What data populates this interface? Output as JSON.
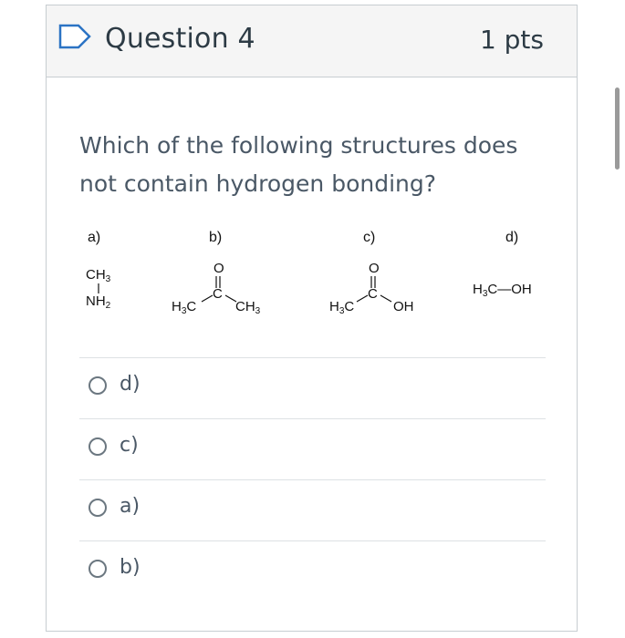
{
  "question": {
    "title": "Question 4",
    "points": "1 pts",
    "text": "Which of the following structures does not contain hydrogen bonding?"
  },
  "structures": {
    "a": {
      "label": "a)",
      "top_group": "CH",
      "top_sub": "3",
      "bottom_group": "NH",
      "bottom_sub": "2"
    },
    "b": {
      "label": "b)",
      "oxygen": "O",
      "carbon": "C",
      "left_group": "H",
      "left_sub": "3",
      "left_tail": "C",
      "right_group": "CH",
      "right_sub": "3"
    },
    "c": {
      "label": "c)",
      "oxygen": "O",
      "carbon": "C",
      "left_group": "H",
      "left_sub": "3",
      "left_tail": "C",
      "right_group": "OH"
    },
    "d": {
      "label": "d)",
      "formula_head": "H",
      "formula_sub": "3",
      "formula_tail": "C—OH"
    }
  },
  "options": [
    {
      "label": "d)"
    },
    {
      "label": "c)"
    },
    {
      "label": "a)"
    },
    {
      "label": "b)"
    }
  ],
  "colors": {
    "header_bg": "#f5f5f5",
    "border": "#c7cdd1",
    "text": "#2d3b45",
    "muted_text": "#4a5866",
    "flag_icon": "#2b73c4"
  }
}
